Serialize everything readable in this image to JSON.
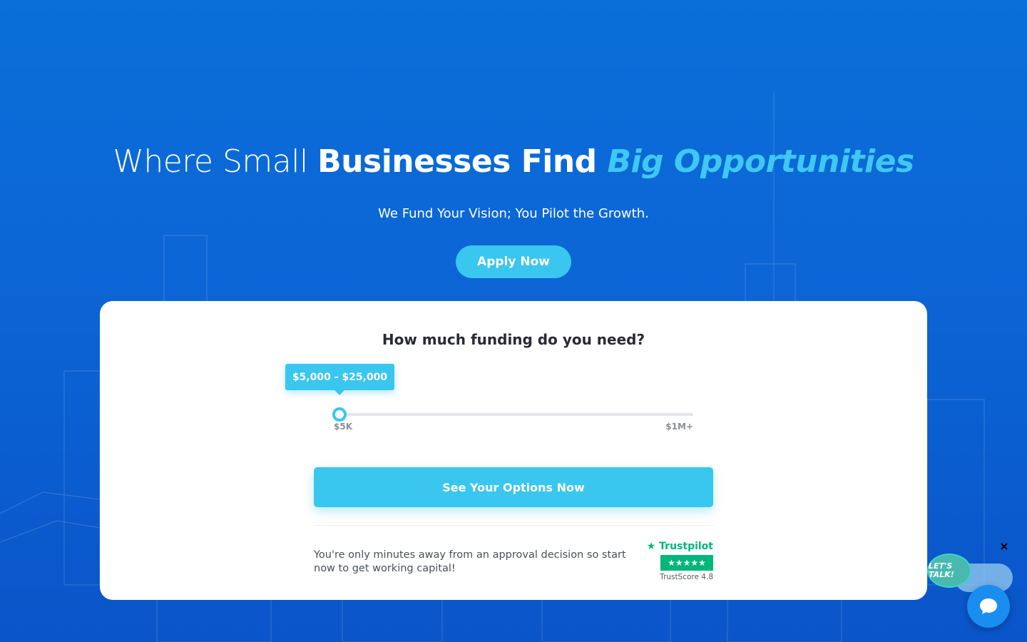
{
  "hero": {
    "title_part1": "Where Small ",
    "title_part2": "Businesses Find ",
    "title_part3": "Big Opportunities",
    "subtitle": "We Fund Your Vision; You Pilot the Growth.",
    "apply_label": "Apply Now"
  },
  "funding_card": {
    "question": "How much funding do you need?",
    "range_tooltip": "$5,000 - $25,000",
    "slider": {
      "min_label": "$5K",
      "max_label": "$1M+",
      "value_fraction": 0.016
    },
    "options_button": "See Your Options Now",
    "footer_note": "You're only minutes away from an approval decision so start now to get working capital!",
    "trustpilot": {
      "brand": "Trustpilot",
      "stars": "★★★★★",
      "score": "TrustScore 4.8"
    }
  },
  "chat_widget": {
    "bubble_text": "LET'S TALK!",
    "close_label": "×"
  },
  "colors": {
    "accent": "#39c6ef",
    "background": "#0a66d6",
    "trustpilot_green": "#00b67a"
  }
}
